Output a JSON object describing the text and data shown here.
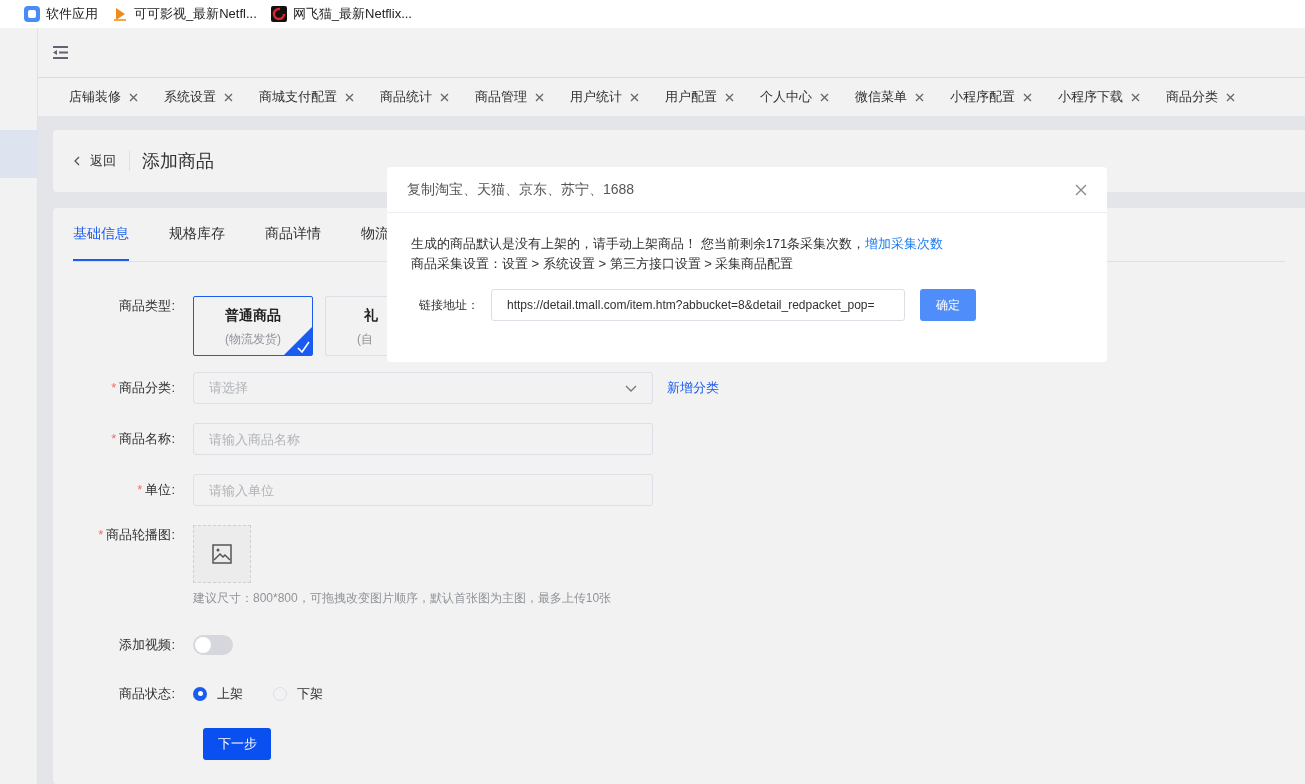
{
  "bookmarks": [
    {
      "label": "软件应用",
      "kind": "app"
    },
    {
      "label": "可可影视_最新Netfl...",
      "kind": "play"
    },
    {
      "label": "网飞猫_最新Netflix...",
      "kind": "cat"
    }
  ],
  "tabs": [
    {
      "label": "店铺装修"
    },
    {
      "label": "系统设置"
    },
    {
      "label": "商城支付配置"
    },
    {
      "label": "商品统计"
    },
    {
      "label": "商品管理"
    },
    {
      "label": "用户统计"
    },
    {
      "label": "用户配置"
    },
    {
      "label": "个人中心"
    },
    {
      "label": "微信菜单"
    },
    {
      "label": "小程序配置"
    },
    {
      "label": "小程序下载"
    },
    {
      "label": "商品分类"
    }
  ],
  "page_header": {
    "back": "返回",
    "title": "添加商品"
  },
  "form_tabs": [
    {
      "label": "基础信息",
      "selected": true
    },
    {
      "label": "规格库存",
      "selected": false
    },
    {
      "label": "商品详情",
      "selected": false
    },
    {
      "label": "物流",
      "selected": false
    }
  ],
  "form": {
    "type_label": "商品类型:",
    "types": [
      {
        "name": "普通商品",
        "sub": "(物流发货)",
        "selected": true
      },
      {
        "name": "礼",
        "sub": "(自",
        "selected": false
      }
    ],
    "fields": [
      {
        "label": "商品分类:",
        "kind": "select",
        "placeholder": "请选择",
        "link": "新增分类",
        "required": "*"
      },
      {
        "label": "商品名称:",
        "kind": "input",
        "placeholder": "请输入商品名称",
        "required": "*"
      },
      {
        "label": "单位:",
        "kind": "input",
        "placeholder": "请输入单位",
        "required": "*"
      }
    ],
    "carousel": {
      "label": "商品轮播图:",
      "required": "*",
      "hint": "建议尺寸：800*800，可拖拽改变图片顺序，默认首张图为主图，最多上传10张"
    },
    "video": {
      "label": "添加视频:",
      "on": false
    },
    "status": {
      "label": "商品状态:",
      "options": [
        {
          "label": "上架",
          "selected": true
        },
        {
          "label": "下架",
          "selected": false
        }
      ]
    },
    "next": "下一步"
  },
  "dialog": {
    "title": "复制淘宝、天猫、京东、苏宁、1688",
    "notice": "生成的商品默认是没有上架的，请手动上架商品！ 您当前剩余171条采集次数，",
    "notice_link": "增加采集次数",
    "path": "商品采集设置：设置 > 系统设置 > 第三方接口设置 > 采集商品配置",
    "url_label": "链接地址：",
    "url": "https://detail.tmall.com/item.htm?abbucket=8&detail_redpacket_pop=",
    "confirm": "确定"
  }
}
